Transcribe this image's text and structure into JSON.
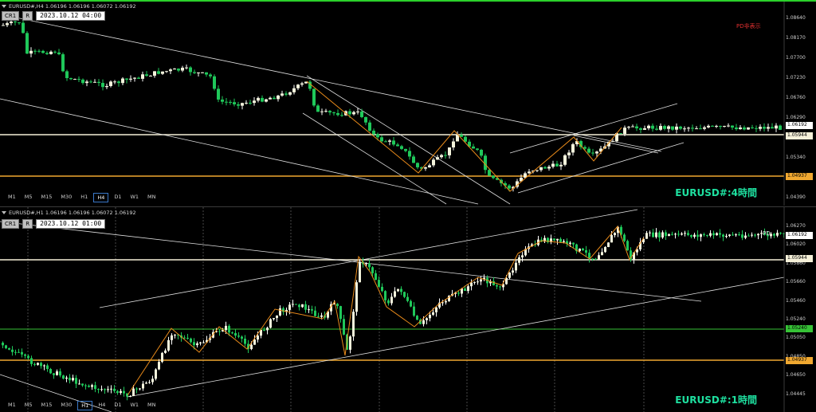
{
  "top": {
    "header": "EURUSD#,H4  1.06196 1.06196 1.06072 1.06192",
    "toolbar": {
      "btn1": "CR1",
      "btn2": "R",
      "timestamp": "2023.10.12 04:00"
    },
    "note": "PD非表示",
    "note_color": "#e03030",
    "title": "EURUSD#:4時間",
    "timeframes": [
      "M1",
      "M5",
      "M15",
      "M30",
      "H1",
      "H4",
      "D1",
      "W1",
      "MN"
    ],
    "active_timeframe": "H4",
    "axis": [
      "1.08640",
      "1.08170",
      "1.07700",
      "1.07230",
      "1.06760",
      "1.06290",
      "1.05810",
      "1.05340",
      "1.04870",
      "1.04390"
    ],
    "price_tags": [
      {
        "label": "1.06192",
        "color": "#ffffff"
      },
      {
        "label": "1.05944",
        "color": "#f5f0d8"
      },
      {
        "label": "1.04937",
        "color": "#f0a830"
      }
    ]
  },
  "bottom": {
    "header": "EURUSD#,H1  1.06196 1.06196 1.06072 1.06192",
    "toolbar": {
      "btn1": "CR1",
      "btn2": "R",
      "timestamp": "2023.10.12 01:00"
    },
    "note": "PD",
    "note_color": "#e0e0e0",
    "title": "EURUSD#:1時間",
    "timeframes": [
      "M1",
      "M5",
      "M15",
      "M30",
      "H1",
      "H4",
      "D1",
      "W1",
      "MN"
    ],
    "active_timeframe": "H1",
    "axis": [
      "1.06270",
      "1.06020",
      "1.05860",
      "1.05660",
      "1.05460",
      "1.05240",
      "1.05050",
      "1.04850",
      "1.04650",
      "1.04445"
    ],
    "price_tags": [
      {
        "label": "1.06192",
        "color": "#ffffff"
      },
      {
        "label": "1.05944",
        "color": "#f5f0d8"
      },
      {
        "label": "1.05240",
        "color": "#36c236"
      },
      {
        "label": "1.04937",
        "color": "#f0a830"
      }
    ]
  }
}
